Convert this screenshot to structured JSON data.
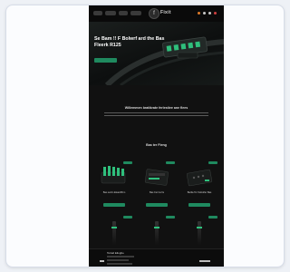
{
  "header": {
    "brand": "Fixit",
    "logo_mark": "f"
  },
  "hero": {
    "title": "Se Bam !! F Bolwrf ard the Bas Fleerk R125",
    "subtitle": "",
    "cta_label": ""
  },
  "intro": {
    "title": "Willemmen bratikrate ferlestiee ane flees"
  },
  "shop": {
    "title": "Bas ter Fieng",
    "products": [
      {
        "name": "Bas sertin Eleaniffirm",
        "price": ""
      },
      {
        "name": "Bas Ferrns fis",
        "price": ""
      },
      {
        "name": "Bartla Tor Sobofler Bas",
        "price": ""
      }
    ]
  },
  "footer": {
    "label": "Tortail Eliughe"
  },
  "colors": {
    "accent": "#1f8a5f",
    "background": "#111111"
  }
}
